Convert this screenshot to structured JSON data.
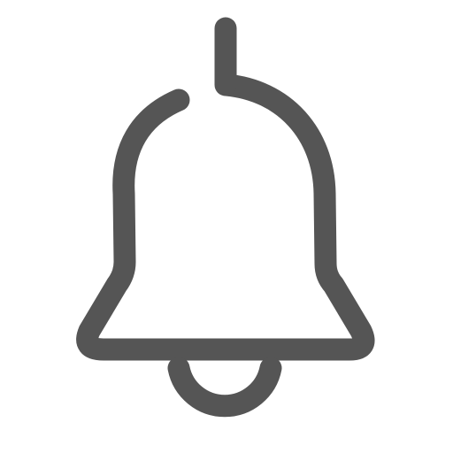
{
  "icon": {
    "name": "bell-icon",
    "stroke_color": "#555555",
    "background_color": "#ffffff"
  }
}
